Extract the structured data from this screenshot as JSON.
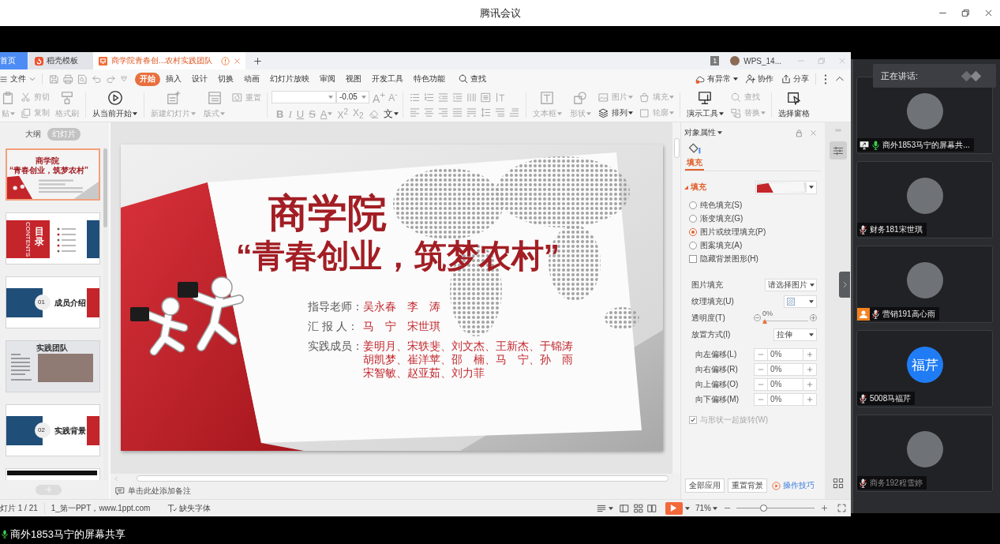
{
  "meeting": {
    "title": "腾讯会议",
    "share_label": "商外1853马宁的屏幕共享"
  },
  "wps": {
    "tabs": [
      {
        "label": "首页",
        "kind": "home",
        "selected": false,
        "warning": false
      },
      {
        "label": "稻壳模板",
        "kind": "docer",
        "selected": false,
        "warning": false
      },
      {
        "label": "商学院青春创...农村实践团队",
        "kind": "doc",
        "selected": true,
        "warning": true
      }
    ],
    "window_count": "1",
    "account": "WPS_14...",
    "file_menu": "文件",
    "menu_tabs": [
      {
        "label": "开始",
        "selected": true
      },
      {
        "label": "插入",
        "selected": false
      },
      {
        "label": "设计",
        "selected": false
      },
      {
        "label": "切换",
        "selected": false
      },
      {
        "label": "动画",
        "selected": false
      },
      {
        "label": "幻灯片放映",
        "selected": false
      },
      {
        "label": "审阅",
        "selected": false
      },
      {
        "label": "视图",
        "selected": false
      },
      {
        "label": "开发工具",
        "selected": false
      },
      {
        "label": "特色功能",
        "selected": false
      }
    ],
    "search": "查找",
    "menu_actions": [
      {
        "label": "有异常",
        "kind": "cloud",
        "caret": true
      },
      {
        "label": "协作",
        "kind": "person",
        "caret": false
      },
      {
        "label": "分享",
        "kind": "share",
        "caret": false
      }
    ],
    "ribbon": [
      {
        "kind": "tools",
        "columns": [
          {
            "kind": "large",
            "items": [
              {
                "label": "贴",
                "kind": "paste",
                "caret": true,
                "disabled": true
              }
            ]
          },
          {
            "kind": "stack",
            "items": [
              {
                "label": "剪切",
                "kind": "cut",
                "caret": false,
                "disabled": true
              },
              {
                "label": "复制",
                "kind": "copy",
                "caret": false,
                "disabled": true
              }
            ]
          },
          {
            "kind": "large",
            "items": [
              {
                "label": "格式刷",
                "kind": "format-painter",
                "caret": false,
                "disabled": true
              }
            ]
          }
        ]
      },
      {
        "kind": "tools",
        "columns": [
          {
            "kind": "large",
            "items": [
              {
                "label": "从当前开始",
                "kind": "play-from-current",
                "caret": true,
                "disabled": false
              }
            ]
          }
        ]
      },
      {
        "kind": "tools",
        "columns": [
          {
            "kind": "large",
            "items": [
              {
                "label": "新建幻灯片",
                "kind": "new-slide",
                "caret": true,
                "disabled": true
              }
            ]
          },
          {
            "kind": "large",
            "items": [
              {
                "label": "版式",
                "kind": "layout",
                "caret": true,
                "disabled": true
              }
            ]
          },
          {
            "kind": "top",
            "items": [
              {
                "label": "重置",
                "kind": "reset",
                "caret": false,
                "disabled": true
              }
            ]
          }
        ]
      },
      {
        "kind": "font",
        "size": "-0.05",
        "size_buttons": [
          {
            "glyph": "A$^{+}$",
            "kind": "grow",
            "caret": false,
            "disabled": true
          },
          {
            "glyph": "A$^{-}$",
            "kind": "shrink",
            "caret": false,
            "disabled": true
          }
        ],
        "buttons": [
          {
            "glyph": "B",
            "kind": "bold",
            "caret": false,
            "disabled": true
          },
          {
            "glyph": "I",
            "kind": "italic",
            "caret": false,
            "disabled": true
          },
          {
            "glyph": "U",
            "kind": "underline",
            "caret": false,
            "disabled": true
          },
          {
            "glyph": "S",
            "kind": "strike",
            "caret": false,
            "disabled": true
          },
          {
            "glyph": "A",
            "kind": "color",
            "caret": true,
            "disabled": true
          },
          {
            "glyph": "X$^{2}$",
            "kind": "superscript",
            "caret": false,
            "disabled": true
          },
          {
            "glyph": "X$_{2}$",
            "kind": "subscript",
            "caret": false,
            "disabled": true
          },
          {
            "kind": "clear",
            "caret": false,
            "disabled": true
          },
          {
            "glyph": "文",
            "kind": "phonetic",
            "caret": true,
            "disabled": false
          }
        ]
      },
      {
        "kind": "paragraph"
      },
      {
        "kind": "tools",
        "columns": [
          {
            "kind": "large",
            "items": [
              {
                "label": "文本框",
                "kind": "textbox",
                "caret": true,
                "disabled": true
              }
            ]
          },
          {
            "kind": "large",
            "items": [
              {
                "label": "形状",
                "kind": "shape",
                "caret": true,
                "disabled": true
              }
            ]
          },
          {
            "kind": "stack",
            "items": [
              {
                "label": "图片",
                "kind": "picture",
                "caret": true,
                "disabled": true
              },
              {
                "label": "排列",
                "kind": "arrange",
                "caret": true,
                "disabled": false
              }
            ]
          },
          {
            "kind": "stack",
            "items": [
              {
                "label": "填充",
                "kind": "fill",
                "caret": true,
                "disabled": true
              },
              {
                "label": "轮廓",
                "kind": "outline",
                "caret": true,
                "disabled": true
              }
            ]
          }
        ]
      },
      {
        "kind": "tools",
        "columns": [
          {
            "kind": "large",
            "items": [
              {
                "label": "演示工具",
                "kind": "presenter-tools",
                "caret": true,
                "disabled": false
              }
            ]
          },
          {
            "kind": "stack",
            "items": [
              {
                "label": "查找",
                "kind": "find",
                "caret": false,
                "disabled": true
              },
              {
                "label": "替换",
                "kind": "replace",
                "caret": true,
                "disabled": true
              }
            ]
          }
        ]
      },
      {
        "kind": "tools",
        "columns": [
          {
            "kind": "large",
            "items": [
              {
                "label": "选择窗格",
                "kind": "selection-pane",
                "caret": false,
                "disabled": false
              }
            ]
          }
        ]
      }
    ]
  },
  "slides_panel": {
    "tabs": [
      {
        "label": "大纲",
        "selected": false
      },
      {
        "label": "幻灯片",
        "selected": true
      }
    ],
    "thumbnails": [
      {
        "kind": "title",
        "selected": true,
        "title": "商学院",
        "subtitle": "“青春创业，筑梦农村”"
      },
      {
        "kind": "contents",
        "selected": false,
        "title": "目录",
        "subtitle": "CONTENTS"
      },
      {
        "kind": "section",
        "selected": false,
        "number": "01",
        "title": "成员介绍"
      },
      {
        "kind": "photo",
        "selected": false,
        "title": "实践团队"
      },
      {
        "kind": "section",
        "selected": false,
        "number": "02",
        "title": "实践背景"
      },
      {
        "kind": "banner",
        "selected": false
      }
    ]
  },
  "slide": {
    "title": "商学院",
    "subtitle": "“青春创业，筑梦农村”",
    "credits": [
      {
        "label": "指导老师：",
        "lines": [
          "吴永春　李　涛"
        ]
      },
      {
        "label": "汇 报 人：",
        "lines": [
          "马　宁　宋世琪"
        ]
      },
      {
        "label": "实践成员：",
        "lines": [
          "姜明月、宋轶斐、刘文杰、王新杰、于锦涛",
          "胡凯梦、崔洋苹、邵　楠、马　宁、孙　雨",
          "宋智敏、赵亚茹、刘力菲"
        ]
      }
    ]
  },
  "notes": {
    "placeholder": "单击此处添加备注"
  },
  "properties": {
    "title": "对象属性",
    "tabs": [
      {
        "label": "填充",
        "selected": true
      }
    ],
    "section": "填充",
    "fill_types": [
      {
        "label": "纯色填充(S)",
        "selected": false
      },
      {
        "label": "渐变填充(G)",
        "selected": false
      },
      {
        "label": "图片或纹理填充(P)",
        "selected": true
      },
      {
        "label": "图案填充(A)",
        "selected": false
      }
    ],
    "hide_background": {
      "label": "隐藏背景图形(H)",
      "checked": false
    },
    "picture_fill": {
      "label": "图片填充",
      "value": "请选择图片"
    },
    "texture_fill": {
      "label": "纹理填充(U)"
    },
    "transparency": {
      "label": "透明度(T)",
      "reading": "0%",
      "level": 0
    },
    "placement": {
      "label": "放置方式(I)",
      "value": "拉伸"
    },
    "offsets": [
      {
        "label": "向左偏移(L)",
        "value": "0%"
      },
      {
        "label": "向右偏移(R)",
        "value": "0%"
      },
      {
        "label": "向上偏移(O)",
        "value": "0%"
      },
      {
        "label": "向下偏移(M)",
        "value": "0%"
      }
    ],
    "rotate_with_shape": {
      "label": "与形状一起旋转(W)",
      "checked": true,
      "disabled": true
    },
    "buttons": [
      "全部应用",
      "重置背景"
    ],
    "tips_link": "操作技巧"
  },
  "side_tools": [
    {
      "kind": "properties",
      "selected": true
    },
    {
      "kind": "apps",
      "selected": false
    }
  ],
  "status_bar": {
    "slide_counter": "灯片 1 / 21",
    "theme": "1_第一PPT，www.1ppt.com",
    "missing_fonts": "缺失字体",
    "zoom": "71%",
    "zoom_slider": {
      "level": 0.34
    }
  },
  "participants": {
    "speaking_label": "正在讲话:",
    "tiles": [
      {
        "name": "商外1853马宁的屏幕共...",
        "muted": false,
        "sharing": true,
        "host": false,
        "faded": false,
        "avatar": {
          "kind": "photo"
        }
      },
      {
        "name": "财务181宋世琪",
        "muted": true,
        "sharing": false,
        "host": false,
        "faded": false,
        "avatar": {
          "kind": "photo"
        }
      },
      {
        "name": "营销191高心雨",
        "muted": true,
        "sharing": false,
        "host": true,
        "faded": false,
        "avatar": {
          "kind": "photo"
        }
      },
      {
        "name": "5008马福芹",
        "muted": true,
        "sharing": false,
        "host": false,
        "faded": false,
        "avatar": {
          "kind": "initials",
          "text": "福芹"
        }
      },
      {
        "name": "商务192程雪婷",
        "muted": true,
        "sharing": false,
        "host": false,
        "faded": true,
        "avatar": {
          "kind": "photo"
        }
      }
    ]
  }
}
